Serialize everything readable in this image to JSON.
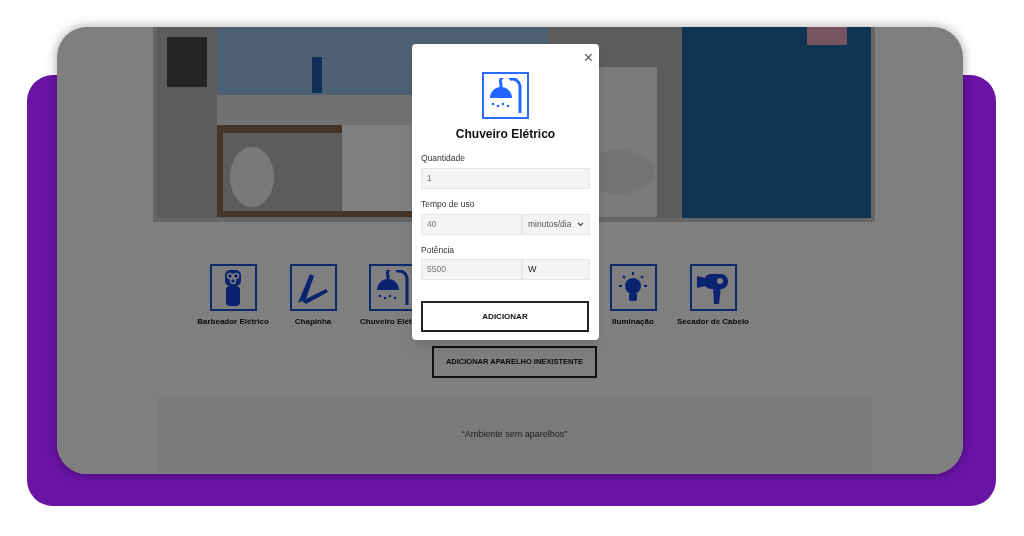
{
  "appliances": [
    {
      "label": "Barbeador Elétrico",
      "kind": "shaver"
    },
    {
      "label": "Chapinha",
      "kind": "straightener"
    },
    {
      "label": "Chuveiro Elét",
      "kind": "shower"
    },
    {
      "kind": "hidden"
    },
    {
      "kind": "hidden"
    },
    {
      "label": "Iluminação",
      "kind": "bulb"
    },
    {
      "label": "Secador de Cabelo",
      "kind": "dryer"
    }
  ],
  "add_missing_button": "ADICIONAR APARELHO INEXISTENTE",
  "empty_message": "“Ambiente sem aparelhos”",
  "modal": {
    "close": "×",
    "title": "Chuveiro Elétrico",
    "kind": "shower",
    "fields": [
      {
        "label": "Quantidade",
        "value": "1",
        "kind": "plain"
      },
      {
        "label": "Tempo de uso",
        "value": "40",
        "unit": "minutos/dia",
        "kind": "select"
      },
      {
        "label": "Potência",
        "value": "5500",
        "unit": "W",
        "kind": "unit"
      }
    ],
    "submit": "ADICIONAR"
  }
}
